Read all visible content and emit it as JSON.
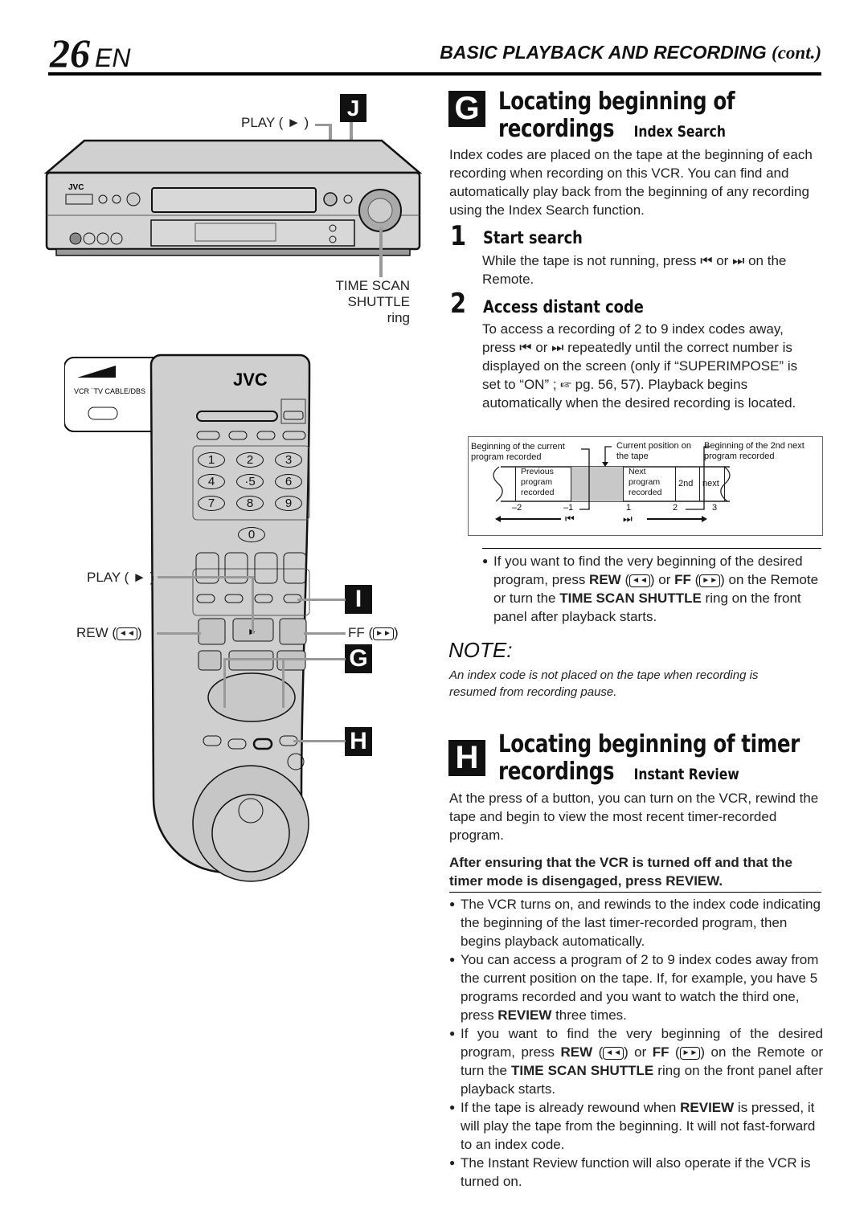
{
  "header": {
    "page_number": "26",
    "language": "EN",
    "section_title": "BASIC PLAYBACK AND RECORDING",
    "section_suffix": "(cont.)"
  },
  "vcr_figure": {
    "brand": "JVC",
    "callout_play": "PLAY ( ► )",
    "callout_shuttle_line1": "TIME SCAN",
    "callout_shuttle_line2": "SHUTTLE ring",
    "badge_j": "J"
  },
  "remote_figure": {
    "brand": "JVC",
    "switch_labels": "VCR ˙TV CABLE/DBS",
    "keypad": [
      "1",
      "2",
      "3",
      "4",
      "·5",
      "6",
      "7",
      "8",
      "9",
      "0"
    ],
    "callout_play": "PLAY ( ► )",
    "callout_rew": "REW (",
    "callout_ff": "FF (",
    "rew_glyph": "◄◄",
    "ff_glyph": "►►",
    "close_paren": ")",
    "badge_i": "I",
    "badge_g": "G",
    "badge_h": "H"
  },
  "section_g": {
    "badge": "G",
    "title_line1": "Locating beginning of",
    "title_line2": "recordings",
    "subtitle": "Index Search",
    "intro": "Index codes are placed on the tape at the beginning of each recording when recording on this VCR. You can find and automatically play back from the beginning of any recording using the Index Search function.",
    "steps": [
      {
        "number": "1",
        "title": "Start search",
        "text": "While the tape is not running, press ⏮ or ⏭ on the Remote."
      },
      {
        "number": "2",
        "title": "Access distant code",
        "text": "To access a recording of 2 to 9 index codes away, press ⏮ or ⏭ repeatedly until the correct number is displayed on the screen (only if “SUPERIMPOSE” is set to “ON” ; ☞ pg. 56, 57). Playback begins automatically when the desired recording is located."
      }
    ],
    "diagram": {
      "label_current_begin": "Beginning of the current program recorded",
      "label_current_pos": "Current position on the tape",
      "label_2nd_next": "Beginning of the 2nd next program recorded",
      "cells": [
        "Previous program recorded",
        "",
        "Next program recorded",
        "2nd",
        "next"
      ],
      "index_numbers": [
        "–2",
        "–1",
        "1",
        "2",
        "3"
      ],
      "prev_button": "⏮",
      "next_button": "⏭"
    },
    "tip_pre": "If you want to find the very beginning of the desired program, press ",
    "tip_rew": "REW",
    "tip_mid": " or ",
    "tip_ff": "FF",
    "tip_mid2": " on the Remote or turn the ",
    "tip_shuttle": "TIME SCAN SHUTTLE",
    "tip_post": " ring on the front panel after playback starts."
  },
  "note": {
    "title": "NOTE:",
    "text": "An index code is not placed on the tape when recording is resumed from recording pause."
  },
  "section_h": {
    "badge": "H",
    "title_line1": "Locating beginning of timer",
    "title_line2": "recordings",
    "subtitle": "Instant Review",
    "intro": "At the press of a button, you can turn on the VCR, rewind the tape and begin to view the most recent timer-recorded program.",
    "instruction": "After ensuring that the VCR is turned off and that the timer mode is disengaged, press REVIEW.",
    "bullets": {
      "b1": "The VCR turns on, and rewinds to the index code indicating the beginning of the last timer-recorded program, then begins playback automatically.",
      "b2_pre": "You can access a program of 2 to 9 index codes away from the current position on the tape. If, for example, you have 5 programs recorded and you want to watch the third one, press ",
      "b2_bold": "REVIEW",
      "b2_post": " three times.",
      "b3_pre": "If you want to find the very beginning of the desired program, press ",
      "b3_rew": "REW",
      "b3_mid": " or ",
      "b3_ff": "FF",
      "b3_mid2": " on the Remote or turn the ",
      "b3_shuttle": "TIME SCAN SHUTTLE",
      "b3_post": " ring on the front panel after playback starts.",
      "b4_pre": "If the tape is already rewound when ",
      "b4_bold": "REVIEW",
      "b4_post": " is pressed, it will play the tape from the beginning. It will not fast-forward to an index code.",
      "b5": "The Instant Review function will also operate if the VCR is turned on."
    }
  }
}
